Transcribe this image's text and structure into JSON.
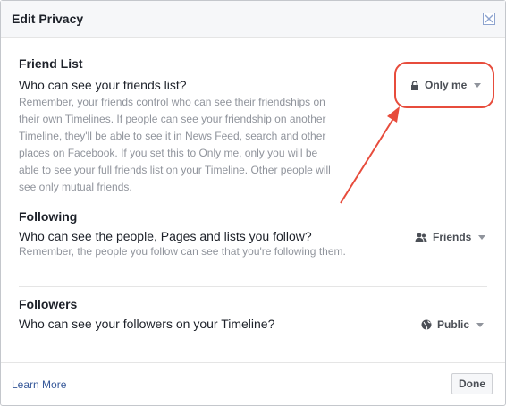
{
  "dialog": {
    "title": "Edit Privacy"
  },
  "sections": [
    {
      "title": "Friend List",
      "question": "Who can see your friends list?",
      "description": "Remember, your friends control who can see their friendships on their own Timelines. If people can see your friendship on another Timeline, they'll be able to see it in News Feed, search and other places on Facebook. If you set this to Only me, only you will be able to see your full friends list on your Timeline. Other people will see only mutual friends.",
      "audience_label": "Only me",
      "audience_icon": "lock-icon"
    },
    {
      "title": "Following",
      "question": "Who can see the people, Pages and lists you follow?",
      "description": "Remember, the people you follow can see that you're following them.",
      "audience_label": "Friends",
      "audience_icon": "friends-icon"
    },
    {
      "title": "Followers",
      "question": "Who can see your followers on your Timeline?",
      "description": "",
      "audience_label": "Public",
      "audience_icon": "globe-icon"
    }
  ],
  "footer": {
    "learn_more": "Learn More",
    "done": "Done"
  },
  "colors": {
    "link": "#365899",
    "annotation": "#e74c3c",
    "muted_text": "#90949c"
  }
}
